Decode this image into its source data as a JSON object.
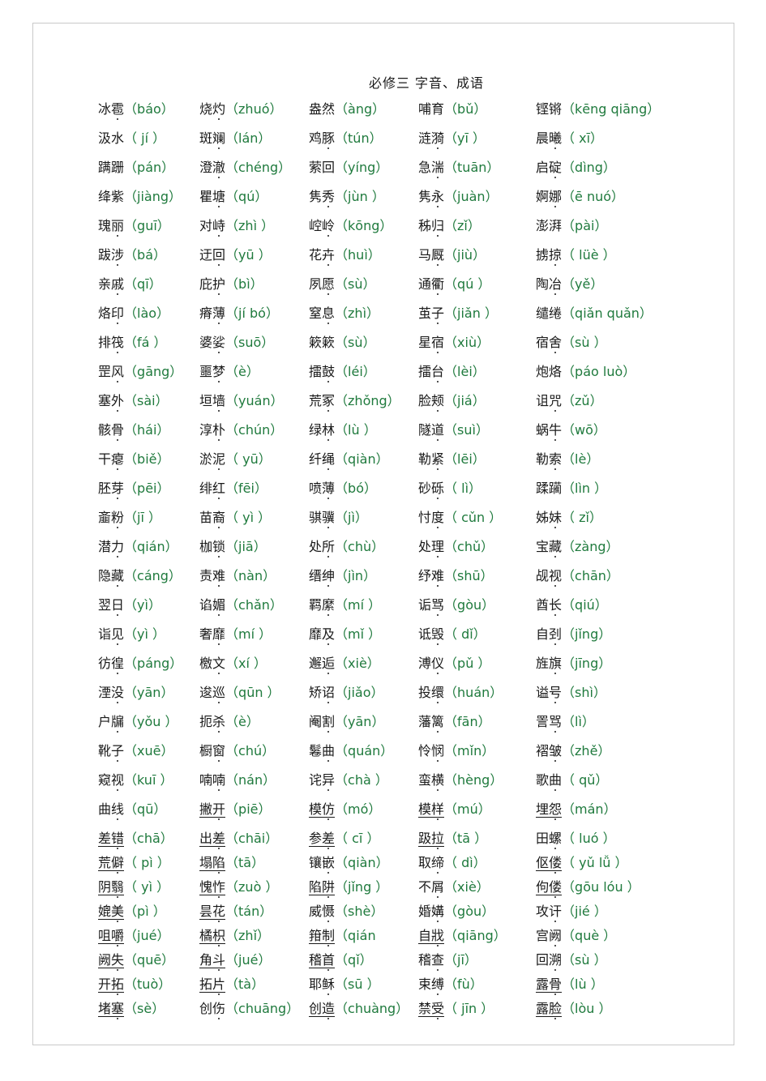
{
  "document": {
    "title": "必修三  字音、成语",
    "rows": [
      [
        {
          "hz": "冰雹",
          "dot": 1,
          "py": "（báo）"
        },
        {
          "hz": "烧灼",
          "dot": 1,
          "py": "（zhuó）"
        },
        {
          "hz": "盎然",
          "dot": 0,
          "py": "（àng）"
        },
        {
          "hz": "哺育",
          "dot": 0,
          "py": "（bǔ）"
        },
        {
          "hz": "铿锵",
          "dot": 0,
          "py": "（kēng qiāng）"
        }
      ],
      [
        {
          "hz": "汲水",
          "dot": 0,
          "py": "（ jí ）"
        },
        {
          "hz": "斑斓",
          "dot": 1,
          "py": "（lán）"
        },
        {
          "hz": "鸡豚",
          "dot": 1,
          "py": "（tún）"
        },
        {
          "hz": "涟漪",
          "dot": 1,
          "py": "（yī ）"
        },
        {
          "hz": "晨曦",
          "dot": 1,
          "py": "（ xī）"
        }
      ],
      [
        {
          "hz": "蹒跚",
          "dot": 0,
          "py": "（pán）"
        },
        {
          "hz": "澄澈",
          "dot": 1,
          "py": "（chéng）"
        },
        {
          "hz": "萦回",
          "dot": 0,
          "py": "（yíng）"
        },
        {
          "hz": "急湍",
          "dot": 1,
          "py": "（tuān）"
        },
        {
          "hz": "启碇",
          "dot": 1,
          "py": "（dìng）"
        }
      ],
      [
        {
          "hz": "绛紫",
          "dot": 0,
          "py": "（jiàng）"
        },
        {
          "hz": "瞿塘",
          "dot": 1,
          "py": "（qú）"
        },
        {
          "hz": "隽秀",
          "dot": 1,
          "py": "（jùn ）"
        },
        {
          "hz": "隽永",
          "dot": 1,
          "py": "（juàn）"
        },
        {
          "hz": "婀娜",
          "dot": 1,
          "py": "（ē nuó）"
        }
      ],
      [
        {
          "hz": "瑰丽",
          "dot": 1,
          "py": "（guī）"
        },
        {
          "hz": "对峙",
          "dot": 1,
          "py": "（zhì ）"
        },
        {
          "hz": "崆岭",
          "dot": 1,
          "py": "（kōng）"
        },
        {
          "hz": "秭归",
          "dot": 1,
          "py": "（zǐ）"
        },
        {
          "hz": "澎湃",
          "dot": 0,
          "py": "（pài）"
        }
      ],
      [
        {
          "hz": "跋涉",
          "dot": 1,
          "py": "（bá）"
        },
        {
          "hz": "迂回",
          "dot": 1,
          "py": "（yū ）"
        },
        {
          "hz": "花卉",
          "dot": 1,
          "py": "（huì）"
        },
        {
          "hz": "马厩",
          "dot": 1,
          "py": "（jiù）"
        },
        {
          "hz": "掳掠",
          "dot": 1,
          "py": "（ lüè ）"
        }
      ],
      [
        {
          "hz": "亲戚",
          "dot": 1,
          "py": "（qī）"
        },
        {
          "hz": "庇护",
          "dot": 1,
          "py": "（bì）"
        },
        {
          "hz": "夙愿",
          "dot": 1,
          "py": "（sù）"
        },
        {
          "hz": "通衢",
          "dot": 1,
          "py": "（qú ）"
        },
        {
          "hz": "陶冶",
          "dot": 1,
          "py": "（yě）"
        }
      ],
      [
        {
          "hz": "烙印",
          "dot": 1,
          "py": "（lào）"
        },
        {
          "hz": "瘠薄",
          "dot": 1,
          "py": "（jí bó）"
        },
        {
          "hz": "窒息",
          "dot": 1,
          "py": "（zhì）"
        },
        {
          "hz": "茧子",
          "dot": 1,
          "py": "（jiǎn ）"
        },
        {
          "hz": "缱绻",
          "dot": 0,
          "py": "（qiǎn quǎn）"
        }
      ],
      [
        {
          "hz": "排筏",
          "dot": 1,
          "py": "（fá ）"
        },
        {
          "hz": "婆娑",
          "dot": 1,
          "py": "（suō）"
        },
        {
          "hz": "簌簌",
          "dot": 0,
          "py": "（sù）"
        },
        {
          "hz": "星宿",
          "dot": 1,
          "py": "（xiù）"
        },
        {
          "hz": "宿舍",
          "dot": 1,
          "py": "（sù ）"
        }
      ],
      [
        {
          "hz": "罡风",
          "dot": 1,
          "py": "（gāng）"
        },
        {
          "hz": "噩梦",
          "dot": 1,
          "py": "（è）"
        },
        {
          "hz": "擂鼓",
          "dot": 1,
          "py": "（léi）"
        },
        {
          "hz": "擂台",
          "dot": 1,
          "py": "（lèi）"
        },
        {
          "hz": "炮烙",
          "dot": 0,
          "py": "（páo luò）"
        }
      ],
      [
        {
          "hz": "塞外",
          "dot": 1,
          "py": "（sài）"
        },
        {
          "hz": "垣墙",
          "dot": 1,
          "py": "（yuán）"
        },
        {
          "hz": "荒冢",
          "dot": 1,
          "py": "（zhǒng）"
        },
        {
          "hz": "脸颊",
          "dot": 1,
          "py": "（jiá）"
        },
        {
          "hz": "诅咒",
          "dot": 1,
          "py": "（zǔ）"
        }
      ],
      [
        {
          "hz": "骸骨",
          "dot": 1,
          "py": "（hái）"
        },
        {
          "hz": "淳朴",
          "dot": 1,
          "py": "（chún）"
        },
        {
          "hz": "绿林",
          "dot": 1,
          "py": "（lù ）"
        },
        {
          "hz": "隧道",
          "dot": 1,
          "py": "（suì）"
        },
        {
          "hz": "蜗牛",
          "dot": 1,
          "py": "（wō）"
        }
      ],
      [
        {
          "hz": "干瘪",
          "dot": 1,
          "py": "（biě）"
        },
        {
          "hz": "淤泥",
          "dot": 1,
          "py": "（ yū）"
        },
        {
          "hz": "纤绳",
          "dot": 1,
          "py": "（qiàn）"
        },
        {
          "hz": "勒紧",
          "dot": 1,
          "py": "（lēi）"
        },
        {
          "hz": "勒索",
          "dot": 1,
          "py": "（lè）"
        }
      ],
      [
        {
          "hz": "胚芽",
          "dot": 1,
          "py": "（pēi）"
        },
        {
          "hz": "绯红",
          "dot": 1,
          "py": "（fēi）"
        },
        {
          "hz": "喷薄",
          "dot": 1,
          "py": "（bó）"
        },
        {
          "hz": "砂砾",
          "dot": 1,
          "py": "（ lì）"
        },
        {
          "hz": "蹂躏",
          "dot": 0,
          "py": "（lìn ）"
        }
      ],
      [
        {
          "hz": "齑粉",
          "dot": 1,
          "py": "（jī ）"
        },
        {
          "hz": "苗裔",
          "dot": 1,
          "py": "（ yì ）"
        },
        {
          "hz": "骐骥",
          "dot": 1,
          "py": "（jì）"
        },
        {
          "hz": "忖度",
          "dot": 1,
          "py": "（ cǔn ）"
        },
        {
          "hz": "姊妹",
          "dot": 1,
          "py": "（ zǐ）"
        }
      ],
      [
        {
          "hz": "潜力",
          "dot": 1,
          "py": "（qián）"
        },
        {
          "hz": "枷锁",
          "dot": 1,
          "py": "（jiā）"
        },
        {
          "hz": "处所",
          "dot": 1,
          "py": "（chù）"
        },
        {
          "hz": "处理",
          "dot": 1,
          "py": "（chǔ）"
        },
        {
          "hz": "宝藏",
          "dot": 1,
          "py": "（zàng）"
        }
      ],
      [
        {
          "hz": "隐藏",
          "dot": 1,
          "py": "（cáng）"
        },
        {
          "hz": "责难",
          "dot": 1,
          "py": "（nàn）"
        },
        {
          "hz": "缙绅",
          "dot": 1,
          "py": "（jìn）"
        },
        {
          "hz": "纾难",
          "dot": 1,
          "py": "（shū）"
        },
        {
          "hz": "觇视",
          "dot": 1,
          "py": "（chān）"
        }
      ],
      [
        {
          "hz": "翌日",
          "dot": 1,
          "py": "（yì）"
        },
        {
          "hz": "谄媚",
          "dot": 1,
          "py": "（chǎn）"
        },
        {
          "hz": "羁縻",
          "dot": 1,
          "py": "（mí ）"
        },
        {
          "hz": "诟骂",
          "dot": 1,
          "py": "（gòu）"
        },
        {
          "hz": "酋长",
          "dot": 1,
          "py": "（qiú）"
        }
      ],
      [
        {
          "hz": "诣见",
          "dot": 1,
          "py": "（yì ）"
        },
        {
          "hz": "奢靡",
          "dot": 1,
          "py": "（mí ）"
        },
        {
          "hz": "靡及",
          "dot": 1,
          "py": "（mǐ ）"
        },
        {
          "hz": "诋毁",
          "dot": 1,
          "py": "（ dǐ）"
        },
        {
          "hz": "自刭",
          "dot": 1,
          "py": "（jǐng）"
        }
      ],
      [
        {
          "hz": "彷徨",
          "dot": 1,
          "py": "（páng）"
        },
        {
          "hz": "檄文",
          "dot": 1,
          "py": "（xí ）"
        },
        {
          "hz": "邂逅",
          "dot": 1,
          "py": "（xiè）"
        },
        {
          "hz": "溥仪",
          "dot": 1,
          "py": "（pǔ ）"
        },
        {
          "hz": "旌旗",
          "dot": 1,
          "py": "（jīng）"
        }
      ],
      [
        {
          "hz": "湮没",
          "dot": 1,
          "py": "（yān）"
        },
        {
          "hz": "逡巡",
          "dot": 1,
          "py": "（qūn ）"
        },
        {
          "hz": "矫诏",
          "dot": 1,
          "py": "（jiǎo）"
        },
        {
          "hz": "投缳",
          "dot": 1,
          "py": "（huán）"
        },
        {
          "hz": "谥号",
          "dot": 1,
          "py": "（shì）"
        }
      ],
      [
        {
          "hz": "户牖",
          "dot": 1,
          "py": "（yǒu ）"
        },
        {
          "hz": "扼杀",
          "dot": 1,
          "py": "（è）"
        },
        {
          "hz": "阉割",
          "dot": 1,
          "py": "（yān）"
        },
        {
          "hz": "藩篱",
          "dot": 1,
          "py": "（fān）"
        },
        {
          "hz": "詈骂",
          "dot": 1,
          "py": "（lì）"
        }
      ],
      [
        {
          "hz": "靴子",
          "dot": 1,
          "py": "（xuē）"
        },
        {
          "hz": "橱窗",
          "dot": 1,
          "py": "（chú）"
        },
        {
          "hz": "鬈曲",
          "dot": 1,
          "py": "（quán）"
        },
        {
          "hz": "怜悯",
          "dot": 1,
          "py": "（mǐn）"
        },
        {
          "hz": "褶皱",
          "dot": 1,
          "py": "（zhě）"
        }
      ],
      [
        {
          "hz": "窥视",
          "dot": 1,
          "py": "（kuī ）"
        },
        {
          "hz": "喃喃",
          "dot": 1,
          "py": "（nán）"
        },
        {
          "hz": "诧异",
          "dot": 1,
          "py": "（chà ）"
        },
        {
          "hz": "蛮横",
          "dot": 1,
          "py": "（hèng）"
        },
        {
          "hz": "歌曲",
          "dot": 1,
          "py": "（ qǔ）"
        }
      ],
      [
        {
          "hz": "曲线",
          "dot": 1,
          "py": "（qū）"
        },
        {
          "hz": "撇开",
          "dot": 1,
          "py": "（piē）",
          "u": 1
        },
        {
          "hz": "模仿",
          "dot": 1,
          "py": "（mó）",
          "u": 1
        },
        {
          "hz": "模样",
          "dot": 1,
          "py": "（mú）",
          "u": 1
        },
        {
          "hz": "埋怨",
          "dot": 1,
          "py": "（mán）",
          "u": 1
        }
      ],
      [
        {
          "hz": "差错",
          "dot": 1,
          "py": "（chā）",
          "u": 1
        },
        {
          "hz": "出差",
          "dot": 1,
          "py": "（chāi）",
          "u": 1
        },
        {
          "hz": "参差",
          "dot": 1,
          "py": "（ cī ）",
          "u": 1
        },
        {
          "hz": "趿拉",
          "dot": 1,
          "py": "（tā ）",
          "u": 1
        },
        {
          "hz": "田螺",
          "dot": 1,
          "py": "（ luó ）"
        }
      ],
      [
        {
          "hz": "荒僻",
          "dot": 1,
          "py": "（ pì ）",
          "u": 1
        },
        {
          "hz": "塌陷",
          "dot": 1,
          "py": "（tā）",
          "u": 1
        },
        {
          "hz": "镶嵌",
          "dot": 1,
          "py": "（qiàn）"
        },
        {
          "hz": "取缔",
          "dot": 1,
          "py": "（ dì）"
        },
        {
          "hz": "伛偻",
          "dot": 1,
          "py": "（ yǔ lǚ    ）",
          "u": 1
        }
      ],
      [
        {
          "hz": "阴翳",
          "dot": 1,
          "py": "（ yì ）",
          "u": 1
        },
        {
          "hz": "愧怍",
          "dot": 1,
          "py": "（zuò ）",
          "u": 1
        },
        {
          "hz": "陷阱",
          "dot": 1,
          "py": "（jǐng ）",
          "u": 1
        },
        {
          "hz": "不屑",
          "dot": 1,
          "py": "（xiè）"
        },
        {
          "hz": "佝偻",
          "dot": 1,
          "py": "（gōu lóu  ）",
          "u": 1
        }
      ],
      [
        {
          "hz": "媲美",
          "dot": 1,
          "py": "（pì ）",
          "u": 1
        },
        {
          "hz": "昙花",
          "dot": 1,
          "py": "（tán）",
          "u": 1
        },
        {
          "hz": "威慑",
          "dot": 1,
          "py": "（shè）"
        },
        {
          "hz": "婚媾",
          "dot": 1,
          "py": "（gòu）"
        },
        {
          "hz": "攻讦",
          "dot": 1,
          "py": "（jié ）"
        }
      ],
      [
        {
          "hz": "咀嚼",
          "dot": 1,
          "py": "（jué）",
          "u": 1
        },
        {
          "hz": "橘枳",
          "dot": 1,
          "py": "（zhǐ）",
          "u": 1
        },
        {
          "hz": "箝制",
          "dot": 1,
          "py": "（qián",
          "u": 1
        },
        {
          "hz": "自戕",
          "dot": 1,
          "py": "（qiāng）",
          "u": 1
        },
        {
          "hz": "宫阙",
          "dot": 1,
          "py": "（què    ）"
        }
      ],
      [
        {
          "hz": "阙失",
          "dot": 1,
          "py": "（quē）",
          "u": 1
        },
        {
          "hz": "角斗",
          "dot": 1,
          "py": "（jué）",
          "u": 1
        },
        {
          "hz": "稽首",
          "dot": 1,
          "py": "（qǐ）",
          "u": 1
        },
        {
          "hz": "稽查",
          "dot": 1,
          "py": "（jī）"
        },
        {
          "hz": "回溯",
          "dot": 1,
          "py": "（sù     ）"
        }
      ],
      [
        {
          "hz": "开拓",
          "dot": 1,
          "py": "（tuò）",
          "u": 1
        },
        {
          "hz": "拓片",
          "dot": 1,
          "py": "（tà）",
          "u": 1
        },
        {
          "hz": "耶稣",
          "dot": 1,
          "py": "（sū ）"
        },
        {
          "hz": "束缚",
          "dot": 1,
          "py": "（fù）"
        },
        {
          "hz": "露骨",
          "dot": 1,
          "py": "（lù ）",
          "u": 1
        }
      ],
      [
        {
          "hz": "堵塞",
          "dot": 1,
          "py": "（sè）",
          "u": 1
        },
        {
          "hz": "创伤",
          "dot": 1,
          "py": "（chuāng）"
        },
        {
          "hz": "创造",
          "dot": 1,
          "py": "（chuàng）",
          "u": 1
        },
        {
          "hz": "禁受",
          "dot": 1,
          "py": "（ jīn ）",
          "u": 1
        },
        {
          "hz": "露脸",
          "dot": 1,
          "py": "（lòu    ）",
          "u": 1
        }
      ]
    ]
  }
}
